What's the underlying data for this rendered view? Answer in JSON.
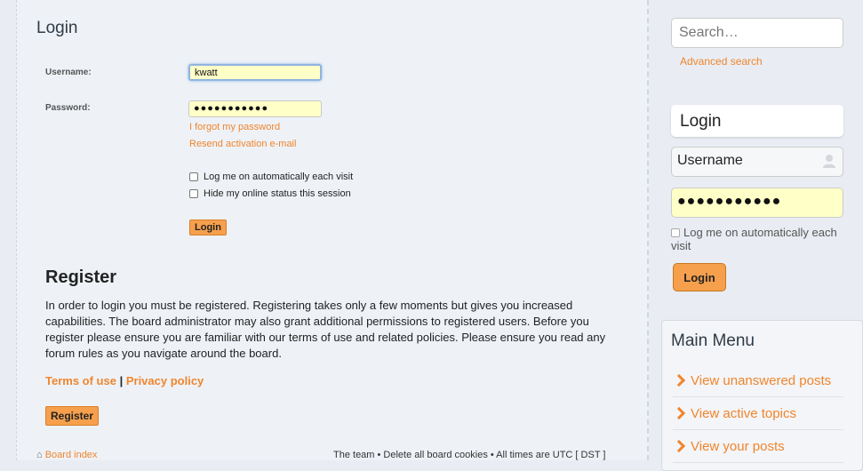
{
  "login": {
    "title": "Login",
    "username_label": "Username:",
    "username_value": "kwatt",
    "password_label": "Password:",
    "password_value": "●●●●●●●●●●●",
    "forgot_password": "I forgot my password",
    "resend_activation": "Resend activation e-mail",
    "auto_login_label": "Log me on automatically each visit",
    "hide_status_label": "Hide my online status this session",
    "login_button": "Login"
  },
  "register": {
    "title": "Register",
    "text": "In order to login you must be registered. Registering takes only a few moments but gives you increased capabilities. The board administrator may also grant additional permissions to registered users. Before you register please ensure you are familiar with our terms of use and related policies. Please ensure you read any forum rules as you navigate around the board.",
    "terms_link": "Terms of use",
    "separator": "|",
    "privacy_link": "Privacy policy",
    "register_button": "Register"
  },
  "footer": {
    "board_index": "Board index",
    "right_text": "The team • Delete all board cookies • All times are UTC [ DST ]"
  },
  "sidebar": {
    "search_placeholder": "Search…",
    "advanced_search": "Advanced search",
    "login_title": "Login",
    "username_placeholder": "Username",
    "password_value": "●●●●●●●●●●●",
    "remember_label": "Log me on automatically each visit",
    "login_button": "Login",
    "main_menu_title": "Main Menu",
    "menu_items": [
      {
        "label": "View unanswered posts"
      },
      {
        "label": "View active topics"
      },
      {
        "label": "View your posts"
      }
    ]
  },
  "colors": {
    "accent": "#f0852d",
    "button": "#f6a04d",
    "input_bg": "#ffffc8"
  }
}
